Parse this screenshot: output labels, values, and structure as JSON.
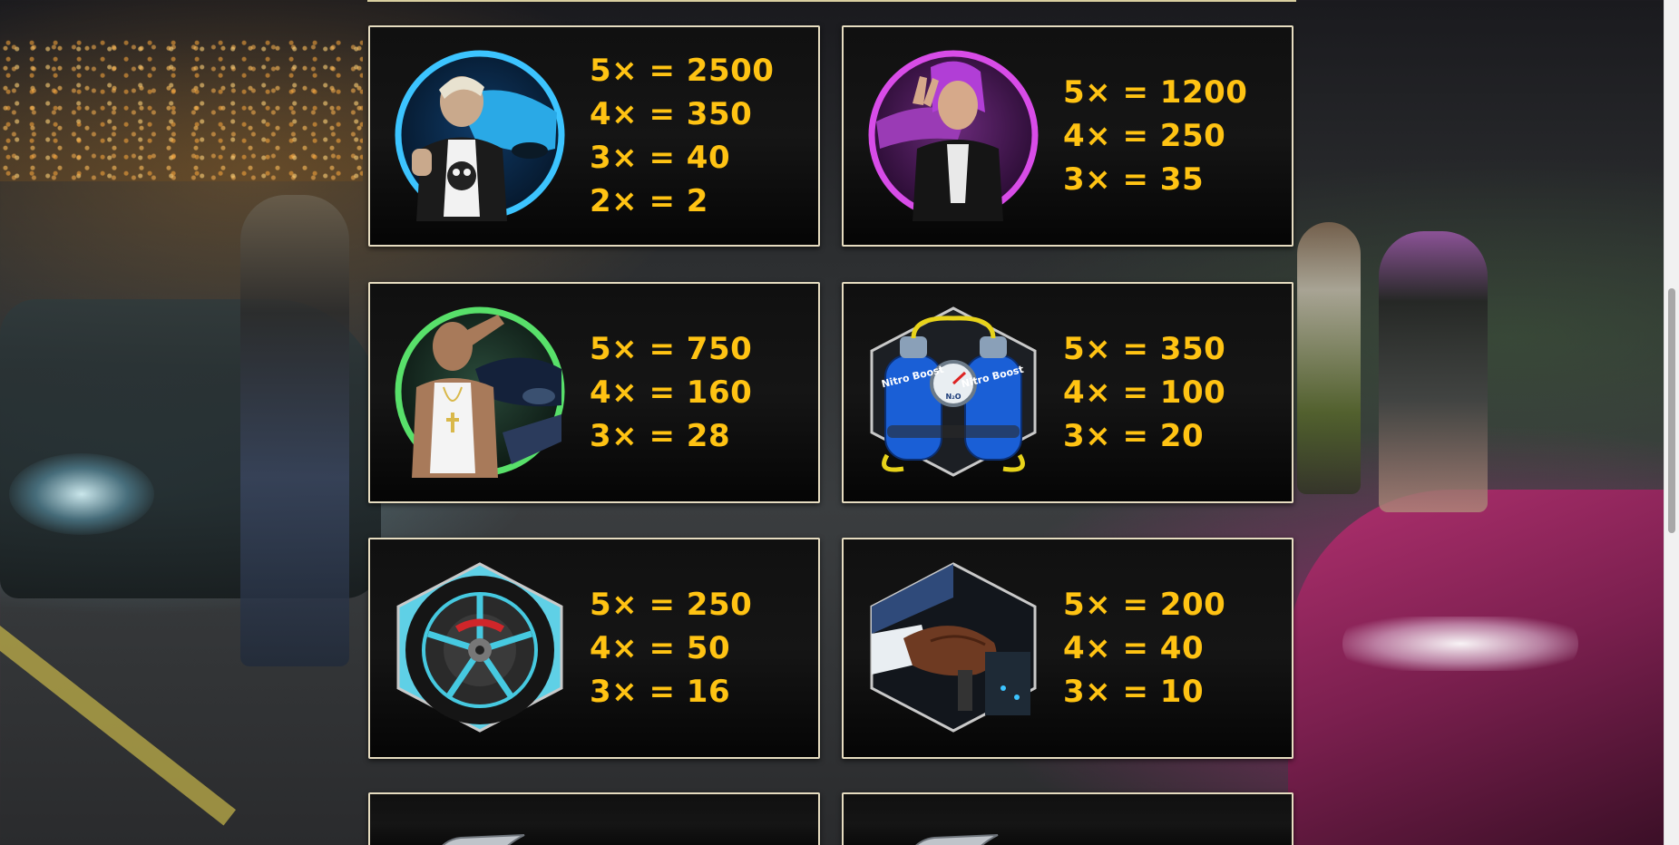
{
  "colors": {
    "payout_text": "#ffc313",
    "card_border": "#e6dcc0",
    "card_bg": "#101010"
  },
  "paytable": [
    {
      "symbol": "blond-man-blue-car-symbol",
      "pays": [
        "5× = 2500",
        "4× = 350",
        "3× = 40",
        "2× = 2"
      ]
    },
    {
      "symbol": "purple-hair-woman-symbol",
      "pays": [
        "5× = 1200",
        "4× = 250",
        "3× = 35"
      ]
    },
    {
      "symbol": "tattooed-man-green-car-symbol",
      "pays": [
        "5× = 750",
        "4× = 160",
        "3× = 28"
      ]
    },
    {
      "symbol": "nitro-boost-tanks-symbol",
      "pays": [
        "5× = 350",
        "4× = 100",
        "3× = 20"
      ]
    },
    {
      "symbol": "wheel-rim-symbol",
      "pays": [
        "5× = 250",
        "4× = 50",
        "3× = 16"
      ]
    },
    {
      "symbol": "gear-shift-glove-symbol",
      "pays": [
        "5× = 200",
        "4× = 40",
        "3× = 10"
      ]
    }
  ],
  "nitro_tank_label": "Nitro Boost",
  "nitro_gauge_label": "N₂O"
}
